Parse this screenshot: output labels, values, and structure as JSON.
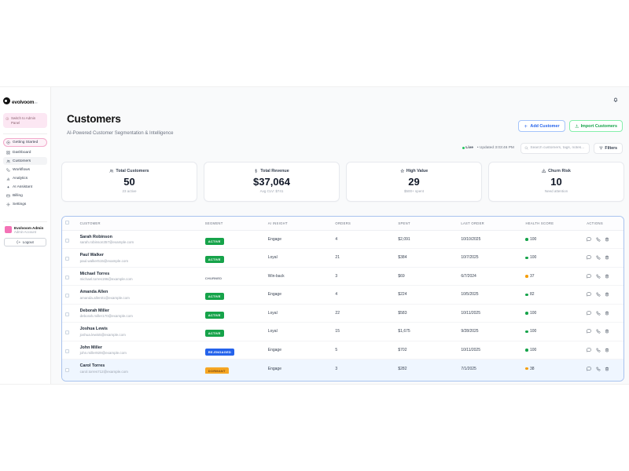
{
  "brand": {
    "name": "evolvoom",
    "tld": ".io"
  },
  "sidebar": {
    "admin_switch": "Switch to Admin Panel",
    "nav": [
      {
        "id": "getting-started",
        "label": "Getting Started",
        "icon": "target-icon",
        "variant": "pill"
      },
      {
        "id": "dashboard",
        "label": "Dashboard",
        "icon": "dashboard-icon"
      },
      {
        "id": "customers",
        "label": "Customers",
        "icon": "customers-icon",
        "active": true
      },
      {
        "id": "workflows",
        "label": "Workflows",
        "icon": "workflows-icon"
      },
      {
        "id": "analytics",
        "label": "Analytics",
        "icon": "analytics-icon"
      },
      {
        "id": "ai-assistant",
        "label": "AI Assistant",
        "icon": "sparkle-icon"
      },
      {
        "id": "billing",
        "label": "Billing",
        "icon": "billing-icon"
      },
      {
        "id": "settings",
        "label": "Settings",
        "icon": "settings-icon"
      }
    ],
    "user": {
      "name": "Evolvoom Admin",
      "role": "Admin Account"
    },
    "logout_label": "Logout"
  },
  "header": {
    "title": "Customers",
    "subtitle": "AI-Powered Customer Segmentation & Intelligence",
    "add_button": "Add Customer",
    "import_button": "Import Customers"
  },
  "statusbar": {
    "live_label": "Live",
    "updated_label": "• Updated 3:03:46 PM",
    "search_placeholder": "Search customers, tags, notes...",
    "filters_label": "Filters"
  },
  "stats": [
    {
      "label": "Total Customers",
      "value": "50",
      "sub": "23 active",
      "icon": "people-icon"
    },
    {
      "label": "Total Revenue",
      "value": "$37,064",
      "sub": "Avg CLV: $741",
      "icon": "dollar-icon"
    },
    {
      "label": "High Value",
      "value": "29",
      "sub": "$500+ spent",
      "icon": "star-icon"
    },
    {
      "label": "Churn Risk",
      "value": "10",
      "sub": "Need attention",
      "icon": "warning-icon"
    }
  ],
  "table": {
    "headers": [
      "Customer",
      "Segment",
      "AI Insight",
      "Orders",
      "Spent",
      "Last Order",
      "Health Score",
      "Actions"
    ],
    "rows": [
      {
        "name": "Sarah Robinson",
        "email": "sarah.robinson357@example.com",
        "segment": "ACTIVE",
        "segment_type": "active",
        "insight": "Engage",
        "orders": "4",
        "spent": "$2,091",
        "last_order": "10/10/2025",
        "health": "100",
        "health_color": "green"
      },
      {
        "name": "Paul Walker",
        "email": "paul.walker515@example.com",
        "segment": "ACTIVE",
        "segment_type": "active",
        "insight": "Loyal",
        "orders": "21",
        "spent": "$384",
        "last_order": "10/7/2025",
        "health": "100",
        "health_color": "green"
      },
      {
        "name": "Michael Torres",
        "email": "michael.torres196@example.com",
        "segment": "CHURNED",
        "segment_type": "churned",
        "insight": "Win-back",
        "orders": "3",
        "spent": "$69",
        "last_order": "6/7/2024",
        "health": "37",
        "health_color": "orange"
      },
      {
        "name": "Amanda Allen",
        "email": "amanda.allen01@example.com",
        "segment": "ACTIVE",
        "segment_type": "active",
        "insight": "Engage",
        "orders": "4",
        "spent": "$224",
        "last_order": "10/5/2025",
        "health": "82",
        "health_color": "green"
      },
      {
        "name": "Deborah Miller",
        "email": "deborah.miller170@example.com",
        "segment": "ACTIVE",
        "segment_type": "active",
        "insight": "Loyal",
        "orders": "22",
        "spent": "$583",
        "last_order": "10/11/2025",
        "health": "100",
        "health_color": "green"
      },
      {
        "name": "Joshua Lewis",
        "email": "joshua.lewis5@example.com",
        "segment": "ACTIVE",
        "segment_type": "active",
        "insight": "Loyal",
        "orders": "15",
        "spent": "$1,675",
        "last_order": "9/28/2025",
        "health": "100",
        "health_color": "green"
      },
      {
        "name": "John Miller",
        "email": "john.miller929@example.com",
        "segment": "RE-ENGAGED",
        "segment_type": "reengaged",
        "insight": "Engage",
        "orders": "5",
        "spent": "$702",
        "last_order": "10/11/2025",
        "health": "100",
        "health_color": "green"
      },
      {
        "name": "Carol Torres",
        "email": "carol.torres712@example.com",
        "segment": "DORMANT",
        "segment_type": "dormant",
        "insight": "Engage",
        "orders": "3",
        "spent": "$282",
        "last_order": "7/1/2025",
        "health": "38",
        "health_color": "orange",
        "selected": true
      }
    ]
  },
  "colors": {
    "accent_blue": "#2563eb",
    "accent_green": "#16a34a",
    "accent_pink": "#f472b6",
    "live_green": "#22c55e",
    "warn_orange": "#f59e0b",
    "table_border": "#a9c3ee",
    "selected_row": "#eff6ff"
  }
}
